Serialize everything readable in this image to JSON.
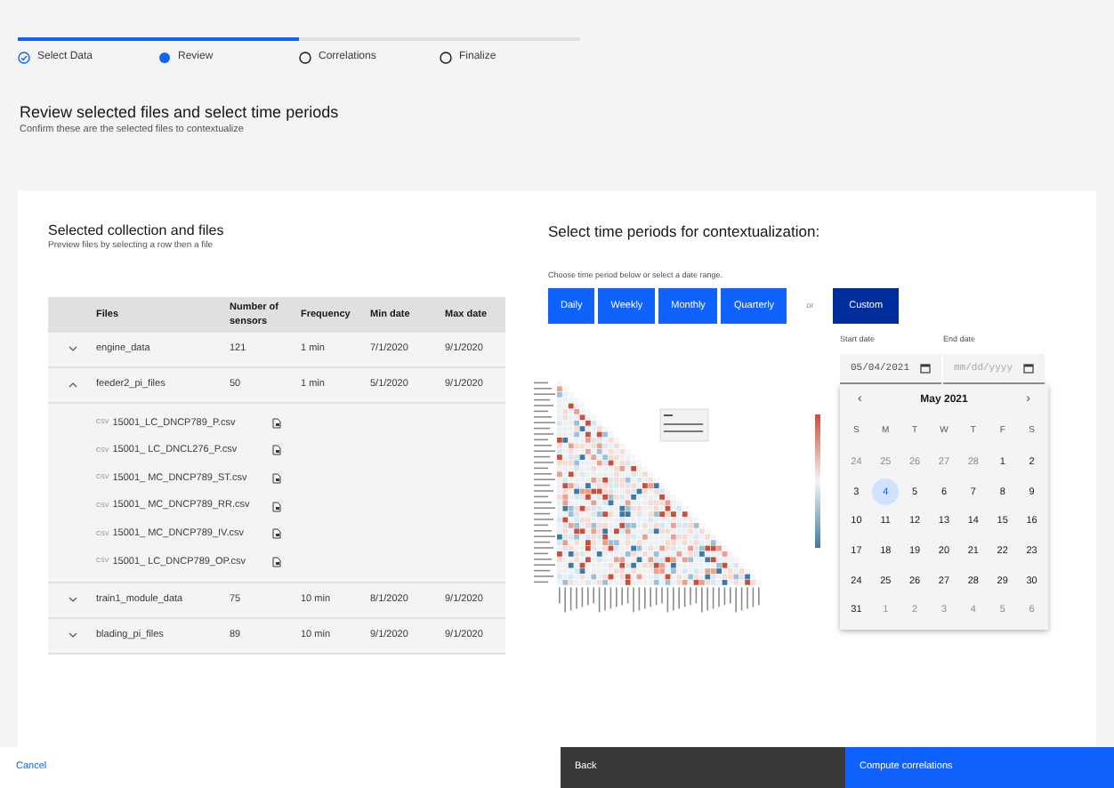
{
  "progress": {
    "level": 0.5
  },
  "steps": [
    {
      "label": "Select Data",
      "completed": true,
      "selected": false
    },
    {
      "label": "Review",
      "completed": false,
      "selected": true
    },
    {
      "label": "Correlations",
      "completed": false,
      "selected": false
    },
    {
      "label": "Finalize",
      "completed": false,
      "selected": false
    }
  ],
  "title": "Review selected files and select time periods",
  "subtitle": "Confirm these are the selected files to contextualize",
  "files_panel": {
    "title": "Selected collection and files",
    "subtitle": "Preview files by selecting a row then a file",
    "columns": [
      "Files",
      "Number of sensors",
      "Frequency",
      "Min date",
      "Max date"
    ],
    "rows": [
      {
        "name": "engine_data",
        "sensors": "121",
        "frequency": "1 min",
        "min_date": "7/1/2020",
        "max_date": "9/1/2020",
        "expanded": false,
        "children": []
      },
      {
        "name": "feeder2_pi_files",
        "sensors": "50",
        "frequency": "1 min",
        "min_date": "5/1/2020",
        "max_date": "9/1/2020",
        "expanded": true,
        "children": [
          {
            "badge": "CSV",
            "name": "15001_LC_DNCP789_P.csv"
          },
          {
            "badge": "CSV",
            "name": "15001_ LC_DNCL276_P.csv"
          },
          {
            "badge": "CSV",
            "name": "15001_ MC_DNCP789_ST.csv"
          },
          {
            "badge": "CSV",
            "name": "15001_ MC_DNCP789_RR.csv"
          },
          {
            "badge": "CSV",
            "name": "15001_ MC_DNCP789_IV.csv"
          },
          {
            "badge": "CSV",
            "name": "15001_ LC_DNCP789_OP.csv"
          }
        ]
      },
      {
        "name": "train1_module_data",
        "sensors": "75",
        "frequency": "10 min",
        "min_date": "8/1/2020",
        "max_date": "9/1/2020",
        "expanded": false,
        "children": []
      },
      {
        "name": "blading_pi_files",
        "sensors": "89",
        "frequency": "10 min",
        "min_date": "9/1/2020",
        "max_date": "9/1/2020",
        "expanded": false,
        "children": []
      }
    ]
  },
  "periods_panel": {
    "title": "Select time periods for contextualization:",
    "hint": "Choose time period below or select a date range.",
    "periods": [
      {
        "label": "Daily",
        "selected": false
      },
      {
        "label": "Weekly",
        "selected": false
      },
      {
        "label": "Monthly",
        "selected": false
      },
      {
        "label": "Quarterly",
        "selected": false
      }
    ],
    "or": "or",
    "custom": {
      "label": "Custom",
      "selected": true
    },
    "start_date": {
      "label": "Start date",
      "value": "05/04/2021"
    },
    "end_date": {
      "label": "End date",
      "placeholder": "mm/dd/yyyy"
    },
    "calendar": {
      "prev": "‹",
      "month": "May 2021",
      "next": "›",
      "weekdays": [
        "S",
        "M",
        "T",
        "W",
        "T",
        "F",
        "S"
      ],
      "weeks": [
        [
          {
            "day": "24",
            "outside": true,
            "selected": false
          },
          {
            "day": "25",
            "outside": true,
            "selected": false
          },
          {
            "day": "26",
            "outside": true,
            "selected": false
          },
          {
            "day": "27",
            "outside": true,
            "selected": false
          },
          {
            "day": "28",
            "outside": true,
            "selected": false
          },
          {
            "day": "1",
            "outside": false,
            "selected": false
          },
          {
            "day": "2",
            "outside": false,
            "selected": false
          }
        ],
        [
          {
            "day": "3",
            "outside": false,
            "selected": false
          },
          {
            "day": "4",
            "outside": false,
            "selected": true
          },
          {
            "day": "5",
            "outside": false,
            "selected": false
          },
          {
            "day": "6",
            "outside": false,
            "selected": false
          },
          {
            "day": "7",
            "outside": false,
            "selected": false
          },
          {
            "day": "8",
            "outside": false,
            "selected": false
          },
          {
            "day": "9",
            "outside": false,
            "selected": false
          }
        ],
        [
          {
            "day": "10",
            "outside": false,
            "selected": false
          },
          {
            "day": "11",
            "outside": false,
            "selected": false
          },
          {
            "day": "12",
            "outside": false,
            "selected": false
          },
          {
            "day": "13",
            "outside": false,
            "selected": false
          },
          {
            "day": "14",
            "outside": false,
            "selected": false
          },
          {
            "day": "15",
            "outside": false,
            "selected": false
          },
          {
            "day": "16",
            "outside": false,
            "selected": false
          }
        ],
        [
          {
            "day": "17",
            "outside": false,
            "selected": false
          },
          {
            "day": "18",
            "outside": false,
            "selected": false
          },
          {
            "day": "19",
            "outside": false,
            "selected": false
          },
          {
            "day": "20",
            "outside": false,
            "selected": false
          },
          {
            "day": "21",
            "outside": false,
            "selected": false
          },
          {
            "day": "22",
            "outside": false,
            "selected": false
          },
          {
            "day": "23",
            "outside": false,
            "selected": false
          }
        ],
        [
          {
            "day": "24",
            "outside": false,
            "selected": false
          },
          {
            "day": "25",
            "outside": false,
            "selected": false
          },
          {
            "day": "26",
            "outside": false,
            "selected": false
          },
          {
            "day": "27",
            "outside": false,
            "selected": false
          },
          {
            "day": "28",
            "outside": false,
            "selected": false
          },
          {
            "day": "29",
            "outside": false,
            "selected": false
          },
          {
            "day": "30",
            "outside": false,
            "selected": false
          }
        ],
        [
          {
            "day": "31",
            "outside": false,
            "selected": false
          },
          {
            "day": "1",
            "outside": true,
            "selected": false
          },
          {
            "day": "2",
            "outside": true,
            "selected": false
          },
          {
            "day": "3",
            "outside": true,
            "selected": false
          },
          {
            "day": "4",
            "outside": true,
            "selected": false
          },
          {
            "day": "5",
            "outside": true,
            "selected": false
          },
          {
            "day": "6",
            "outside": true,
            "selected": false
          }
        ]
      ]
    }
  },
  "footer": {
    "cancel": "Cancel",
    "back": "Back",
    "next": "Compute correlations"
  }
}
